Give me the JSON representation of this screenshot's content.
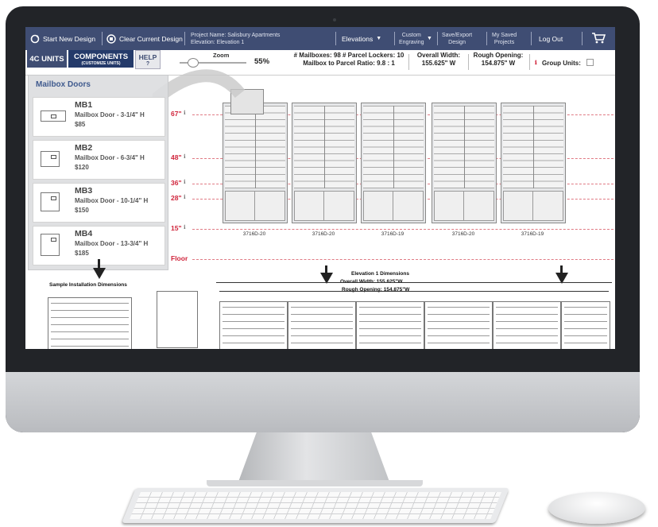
{
  "toolbar": {
    "start_new": "Start New Design",
    "clear_current": "Clear Current Design",
    "project_name": "Project Name: Salisbury Apartments",
    "elevation": "Elevation: Elevation 1",
    "elevations": "Elevations",
    "custom": "Custom",
    "engraving": "Engraving",
    "save_export_1": "Save/Export",
    "save_export_2": "Design",
    "my_saved_1": "My Saved",
    "my_saved_2": "Projects",
    "log_out": "Log Out"
  },
  "nav": {
    "tab_4c": "4C UNITS",
    "tab_components": "COMPONENTS",
    "tab_components_sub": "(CUSTOMIZE UNITS)",
    "tab_help": "HELP",
    "tab_help_sub": "?",
    "zoom_label": "Zoom",
    "zoom_value": "55%",
    "stats_line1": "# Mailboxes: 98  # Parcel Lockers: 10",
    "stats_line2": "Mailbox to Parcel Ratio: 9.8 : 1",
    "width_label": "Overall Width:",
    "width_value": "155.625\" W",
    "rough_label": "Rough Opening:",
    "rough_value": "154.875\" W",
    "group_units": "Group Units:"
  },
  "panel": {
    "title": "Mailbox Doors",
    "items": [
      {
        "code": "MB1",
        "name": "Mailbox Door - 3-1/4\" H",
        "price": "$85"
      },
      {
        "code": "MB2",
        "name": "Mailbox Door - 6-3/4\" H",
        "price": "$120"
      },
      {
        "code": "MB3",
        "name": "Mailbox Door - 10-1/4\" H",
        "price": "$150"
      },
      {
        "code": "MB4",
        "name": "Mailbox Door - 13-3/4\" H",
        "price": "$185"
      }
    ]
  },
  "elevation": {
    "heights": [
      "67\"",
      "48\"",
      "36\"",
      "28\"",
      "15\""
    ],
    "floor": "Floor",
    "unit_labels": [
      "3716D-20",
      "3716D-20",
      "3716D-19",
      "3716D-20",
      "3716D-19"
    ],
    "sample_title": "Sample Installation Dimensions",
    "dim_title": "Elevation 1 Dimensions",
    "dim_width": "Overall Width: 155.625\"W",
    "dim_rough": "Rough Opening: 154.875\"W"
  }
}
